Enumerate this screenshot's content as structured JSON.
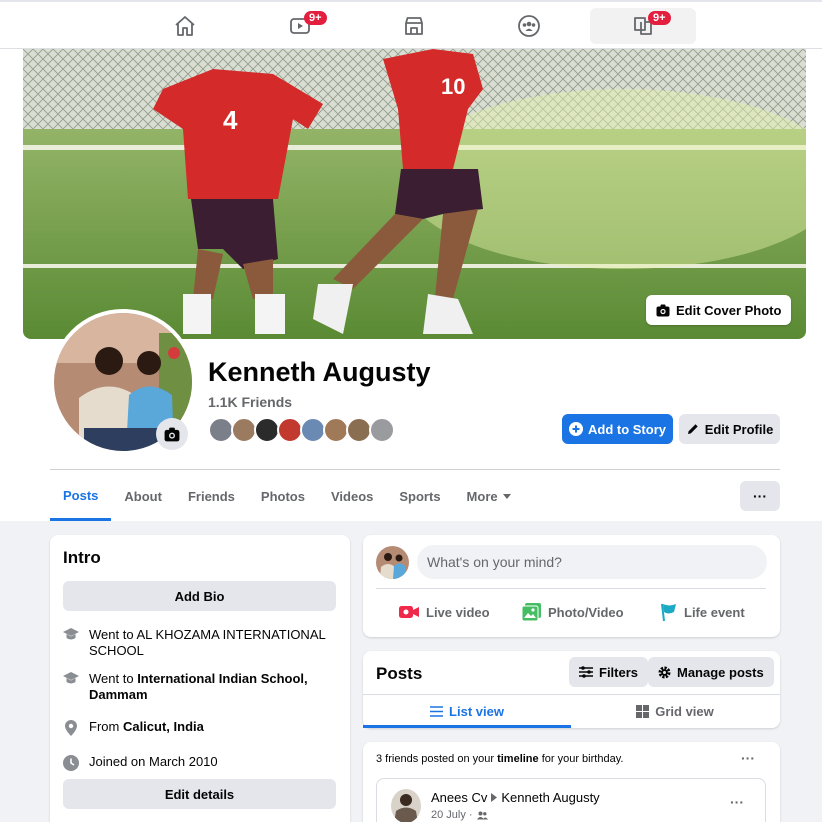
{
  "nav": {
    "items": [
      {
        "icon": "home-icon"
      },
      {
        "icon": "watch-icon",
        "badge": "9+"
      },
      {
        "icon": "marketplace-icon"
      },
      {
        "icon": "groups-icon"
      },
      {
        "icon": "gaming-icon",
        "badge": "9+"
      }
    ]
  },
  "cover": {
    "edit_label": "Edit Cover Photo"
  },
  "profile": {
    "name": "Kenneth Augusty",
    "friends": "1.1K Friends",
    "add_story_label": "Add to Story",
    "edit_profile_label": "Edit Profile"
  },
  "tabs": [
    "Posts",
    "About",
    "Friends",
    "Photos",
    "Videos",
    "Sports",
    "More"
  ],
  "more_button": "···",
  "intro": {
    "title": "Intro",
    "add_bio": "Add Bio",
    "school1_prefix": "Went to ",
    "school1": "AL KHOZAMA INTERNATIONAL SCHOOL",
    "school2_prefix": "Went to ",
    "school2": "International Indian School, Dammam",
    "from_prefix": "From ",
    "from": "Calicut, India",
    "joined": "Joined on March 2010",
    "edit_details": "Edit details"
  },
  "composer": {
    "placeholder": "What's on your mind?",
    "live": "Live video",
    "photo": "Photo/Video",
    "life": "Life event"
  },
  "posts": {
    "title": "Posts",
    "filters": "Filters",
    "manage": "Manage posts",
    "list_view": "List view",
    "grid_view": "Grid view"
  },
  "birthday": {
    "prefix": "3 friends posted on your ",
    "timeline": "timeline",
    "suffix": " for your birthday.",
    "author": "Anees Cv",
    "target": "Kenneth Augusty",
    "date": "20 July ·"
  },
  "colors": {
    "accent": "#1b74e4",
    "badge": "#e41e3f"
  }
}
